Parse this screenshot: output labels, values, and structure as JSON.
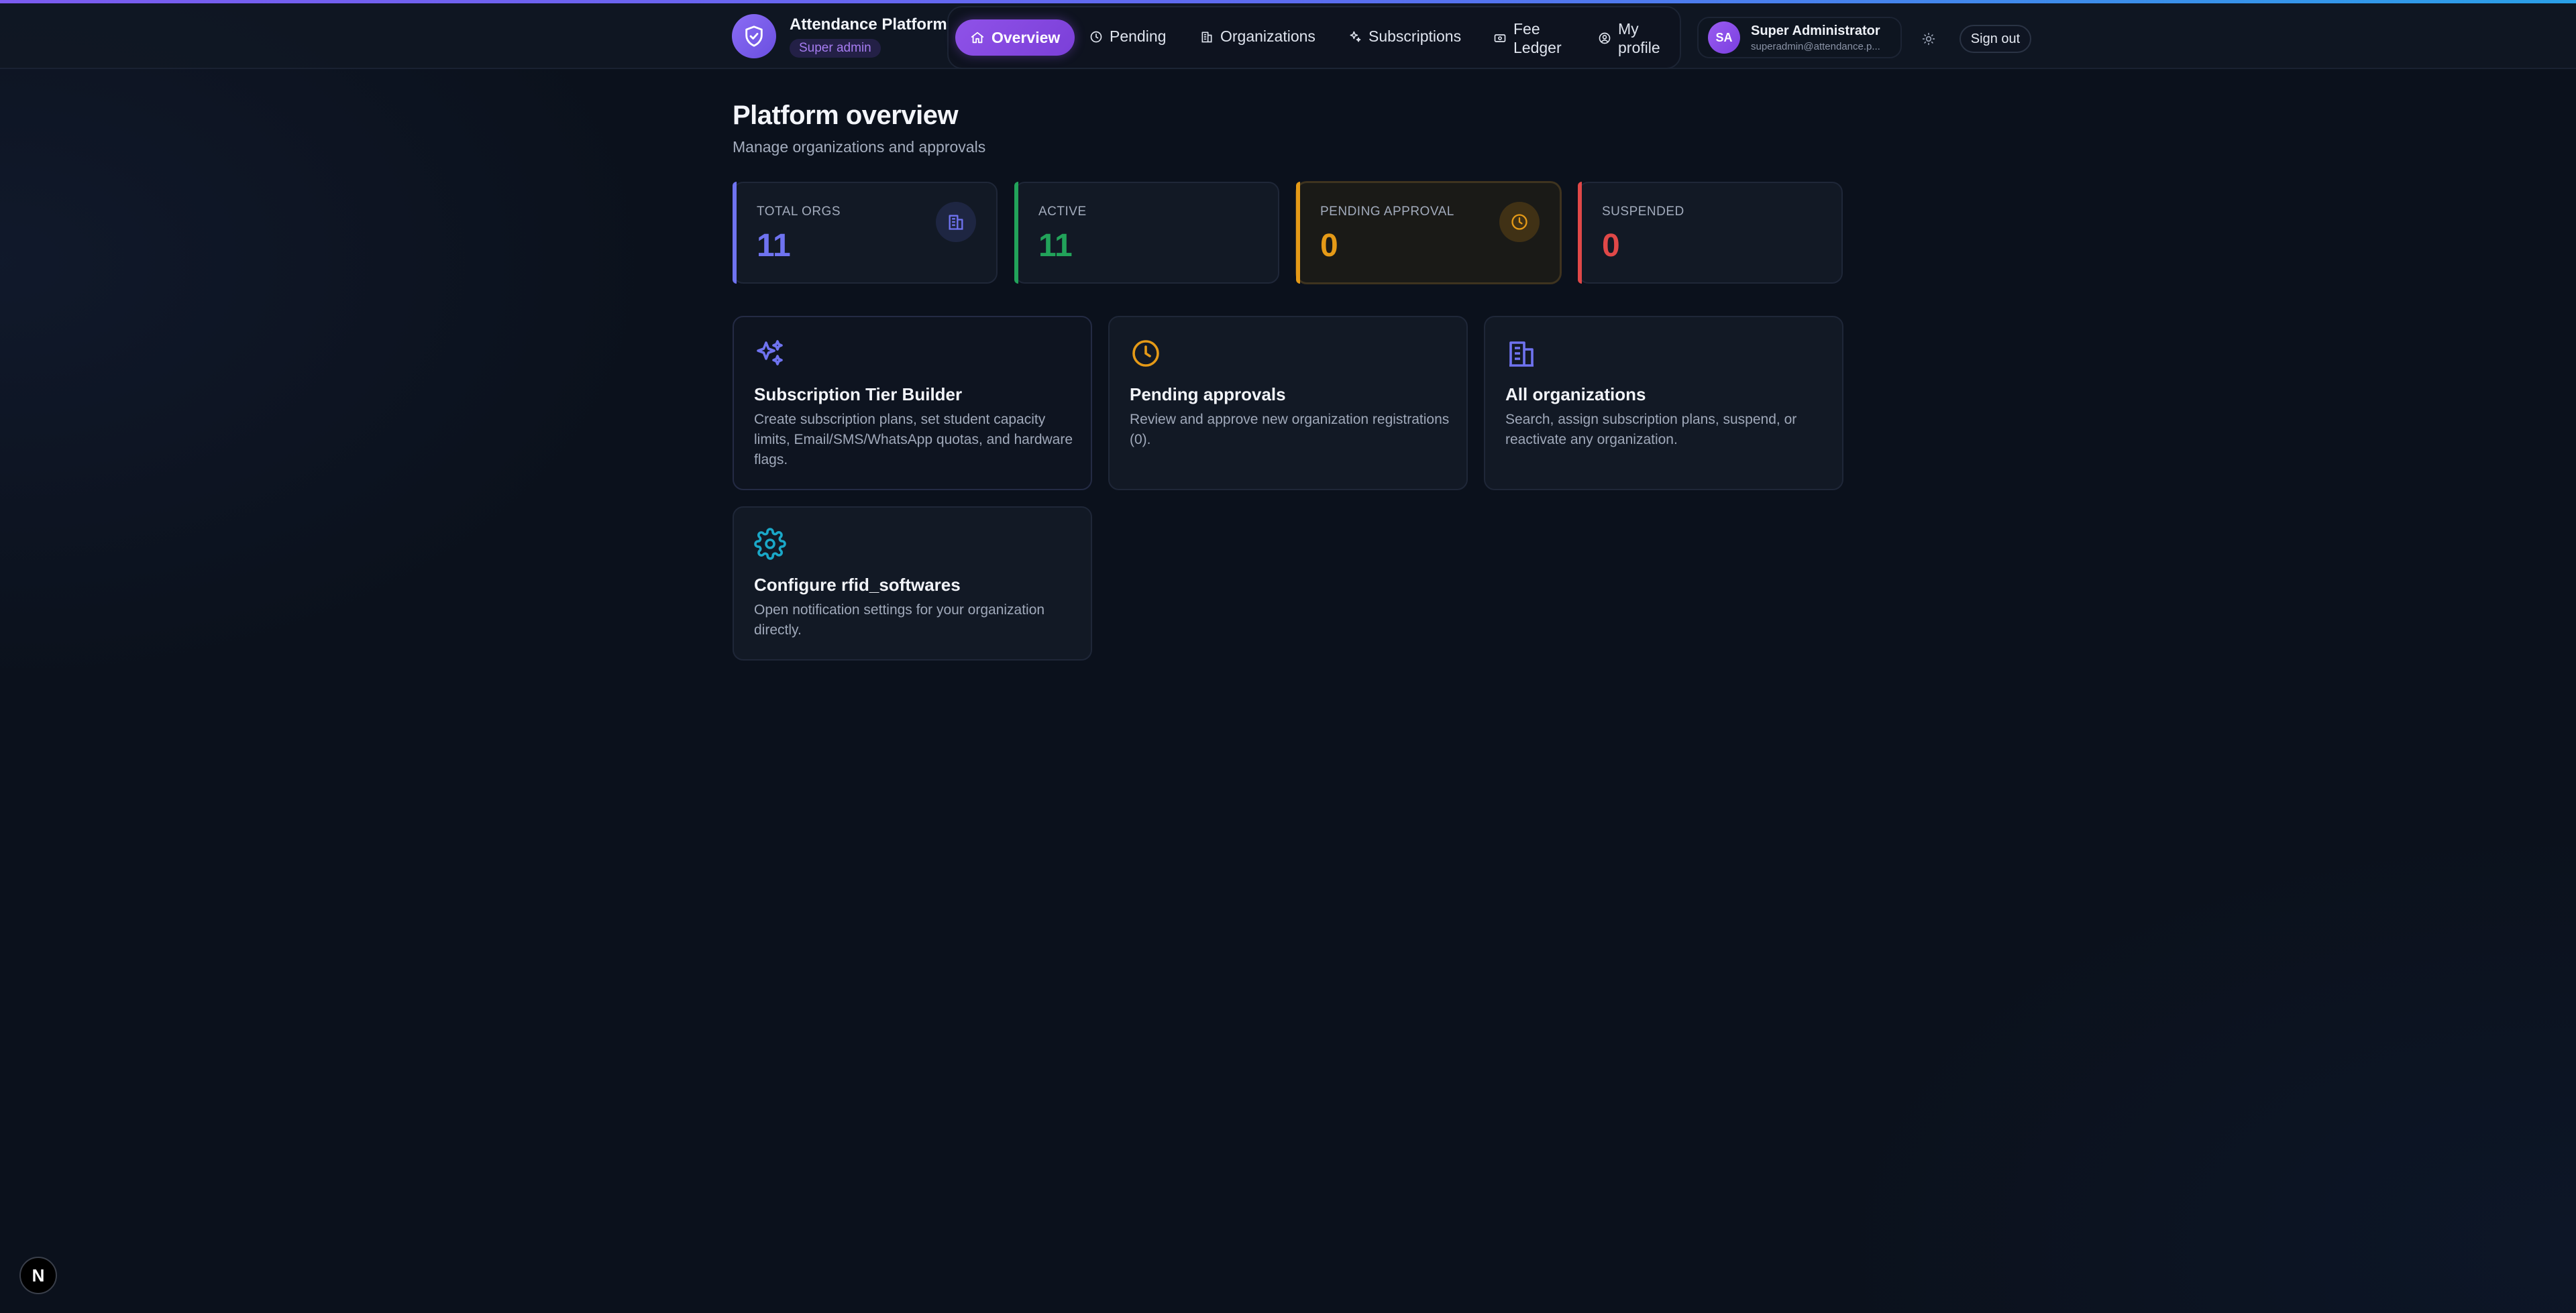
{
  "header": {
    "brand_title": "Attendance Platform",
    "brand_badge": "Super admin",
    "nav": [
      {
        "label": "Overview",
        "icon": "home-icon",
        "active": true
      },
      {
        "label": "Pending",
        "icon": "clock-icon"
      },
      {
        "label": "Organizations",
        "icon": "building-icon"
      },
      {
        "label": "Subscriptions",
        "icon": "sparkles-icon"
      },
      {
        "label_line1": "Fee",
        "label_line2": "Ledger",
        "icon": "receipt-icon"
      },
      {
        "label_line1": "My",
        "label_line2": "profile",
        "icon": "user-circle-icon"
      }
    ],
    "user": {
      "initials": "SA",
      "name": "Super Administrator",
      "email": "superadmin@attendance.p..."
    },
    "sign_out": "Sign out"
  },
  "page": {
    "title": "Platform overview",
    "subtitle": "Manage organizations and approvals"
  },
  "stats": [
    {
      "label": "TOTAL ORGS",
      "value": "11",
      "color": "#6f73f0"
    },
    {
      "label": "ACTIVE",
      "value": "11",
      "color": "#22a35a"
    },
    {
      "label": "PENDING APPROVAL",
      "value": "0",
      "color": "#e59a17"
    },
    {
      "label": "SUSPENDED",
      "value": "0",
      "color": "#e04848"
    }
  ],
  "cards": [
    {
      "title": "Subscription Tier Builder",
      "description": "Create subscription plans, set student capacity limits, Email/SMS/WhatsApp quotas, and hardware flags.",
      "icon": "sparkles-icon"
    },
    {
      "title": "Pending approvals",
      "description": "Review and approve new organization registrations (0).",
      "icon": "clock-icon"
    },
    {
      "title": "All organizations",
      "description": "Search, assign subscription plans, suspend, or reactivate any organization.",
      "icon": "building-icon"
    },
    {
      "title": "Configure rfid_softwares",
      "description": "Open notification settings for your organization directly.",
      "icon": "gear-icon"
    }
  ],
  "dev_badge": "N"
}
